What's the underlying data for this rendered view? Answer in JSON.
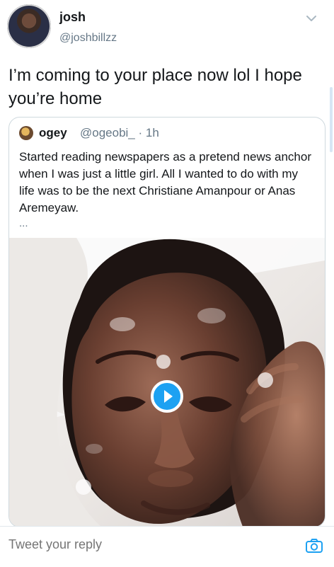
{
  "tweet": {
    "author": {
      "name": "josh",
      "handle": "@joshbillzz"
    },
    "text": "I’m coming to your place now lol I hope you’re home"
  },
  "quote_tweet": {
    "author": {
      "name": "ogey",
      "handle": "@ogeobi_ · 1h"
    },
    "text": "Started reading newspapers as a pretend news anchor when I was just a little girl. All I wanted to do with my life was to be the next Christiane Amanpour or Anas Aremeyaw.",
    "more": "..."
  },
  "reply": {
    "placeholder": "Tweet your reply"
  },
  "icons": {
    "menu": "chevron-down-icon",
    "play": "play-icon",
    "camera": "camera-icon"
  },
  "colors": {
    "accent": "#1da1f2",
    "text": "#14171a",
    "muted": "#657786",
    "border": "#cfd9de"
  }
}
